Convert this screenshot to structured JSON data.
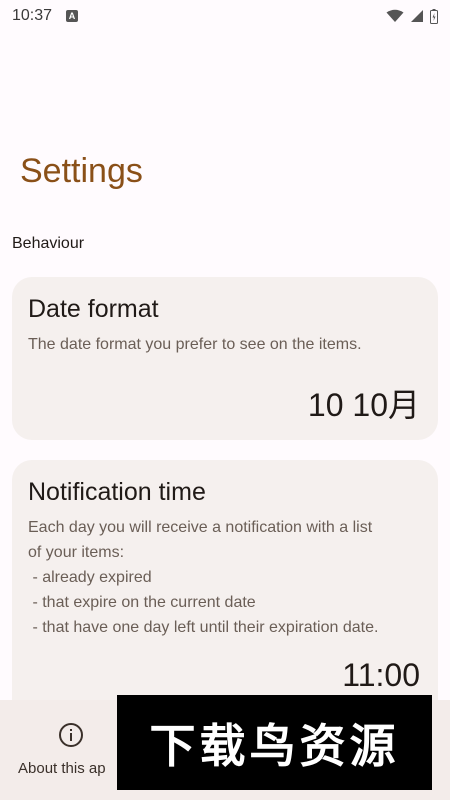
{
  "status_bar": {
    "time": "10:37",
    "indicator": "A",
    "icons": [
      "wifi-icon",
      "signal-icon",
      "battery-icon"
    ]
  },
  "page": {
    "title": "Settings"
  },
  "sections": {
    "behaviour": {
      "header": "Behaviour"
    }
  },
  "date_format": {
    "title": "Date format",
    "description": "The date format you prefer to see on the items.",
    "value": "10 10月"
  },
  "notification_time": {
    "title": "Notification time",
    "description_lines": [
      "Each day you will receive a notification with a list",
      "of your items:",
      " - already expired",
      " - that expire on the current date",
      " - that have one day left until their expiration date."
    ],
    "value": "11:00"
  },
  "bottom_nav": {
    "about_label": "About this ap",
    "about_icon": "info-icon"
  },
  "watermark": {
    "text": "下载鸟资源"
  },
  "colors": {
    "background": "#fffbfe",
    "title": "#8a5018",
    "card": "#f5f0ee",
    "bottom_bar": "#f3ecea"
  }
}
